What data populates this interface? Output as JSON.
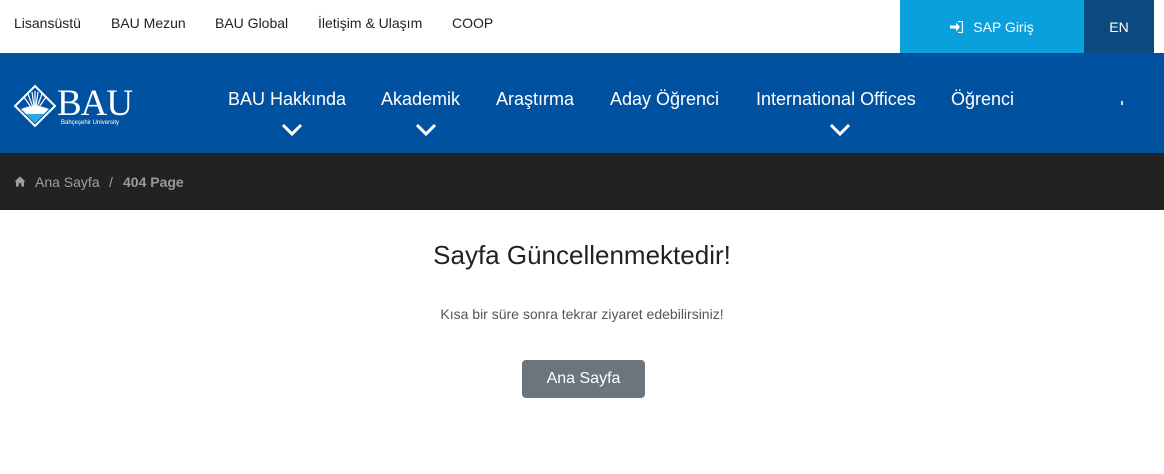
{
  "topbar": {
    "links": [
      "Lisansüstü",
      "BAU Mezun",
      "BAU Global",
      "İletişim & Ulaşım",
      "COOP"
    ],
    "sap_label": "SAP Giriş",
    "lang_label": "EN"
  },
  "logo": {
    "text": "BAU",
    "subtext": "Bahçeşehir University"
  },
  "nav": {
    "items": [
      "BAU Hakkında",
      "Akademik",
      "Araştırma",
      "Aday Öğrenci",
      "International Offices",
      "Öğrenci"
    ]
  },
  "breadcrumb": {
    "home": "Ana Sayfa",
    "separator": "/",
    "current": "404 Page"
  },
  "main": {
    "title": "Sayfa Güncellenmektedir!",
    "subtitle": "Kısa bir süre sonra tekrar ziyaret edebilirsiniz!",
    "button_label": "Ana Sayfa"
  },
  "colors": {
    "nav_bg": "#0052a0",
    "sap_bg": "#0aa0dc",
    "lang_bg": "#0b4a7e",
    "breadcrumb_bg": "#222222",
    "button_bg": "#6c757d"
  },
  "icons": [
    "sign-in-icon",
    "home-icon",
    "chevron-down-icon"
  ]
}
